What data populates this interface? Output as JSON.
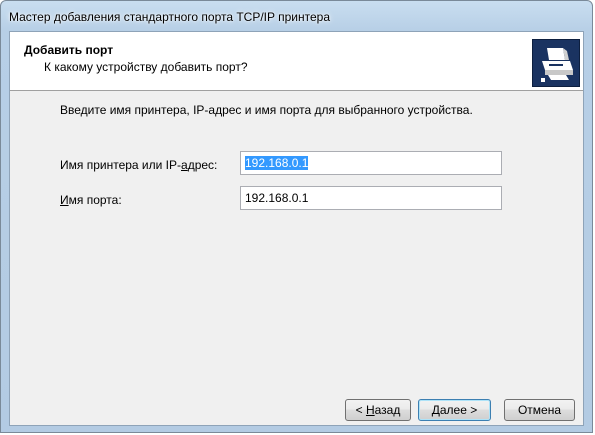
{
  "window": {
    "title": "Мастер добавления стандартного порта TCP/IP принтера"
  },
  "header": {
    "title": "Добавить порт",
    "subtitle": "К какому устройству добавить порт?",
    "icon": "printer-network-icon"
  },
  "body": {
    "instruction": "Введите имя принтера, IP-адрес и имя порта для выбранного устройства.",
    "printer_label": {
      "prefix": "Имя принтера или IP-",
      "accel": "а",
      "suffix": "дрес:"
    },
    "printer_value": "192.168.0.1",
    "port_label": {
      "accel": "И",
      "suffix": "мя порта:"
    },
    "port_value": "192.168.0.1"
  },
  "footer": {
    "back": {
      "prefix": "< ",
      "accel": "Н",
      "suffix": "азад"
    },
    "next": {
      "accel": "Д",
      "suffix": "алее >"
    },
    "cancel": "Отмена"
  },
  "colors": {
    "header_icon_bg": "#1a3361",
    "selection": "#3399ff"
  }
}
